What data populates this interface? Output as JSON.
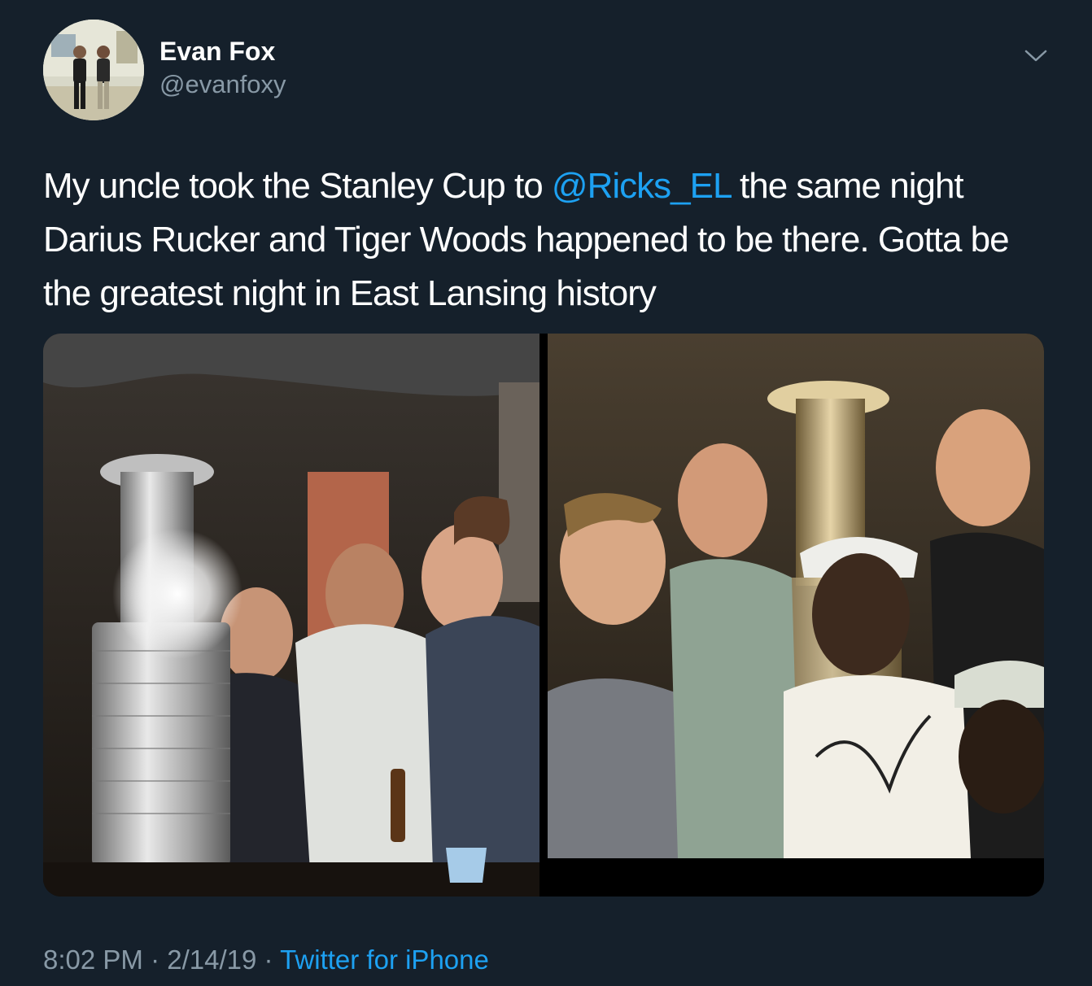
{
  "author": {
    "display_name": "Evan Fox",
    "handle": "@evanfoxy"
  },
  "tweet": {
    "text_part1": "My uncle took the Stanley Cup to ",
    "mention": "@Ricks_EL",
    "text_part2": " the same night Darius Rucker and Tiger Woods happened to be there. Gotta be the greatest night in East Lansing history"
  },
  "meta": {
    "time": "8:02 PM",
    "separator1": " · ",
    "date": "2/14/19",
    "separator2": " · ",
    "source": "Twitter for iPhone"
  },
  "icons": {
    "menu": "chevron-down-icon"
  },
  "colors": {
    "background": "#15202b",
    "link": "#1da1f2",
    "secondary_text": "#8899a6"
  }
}
